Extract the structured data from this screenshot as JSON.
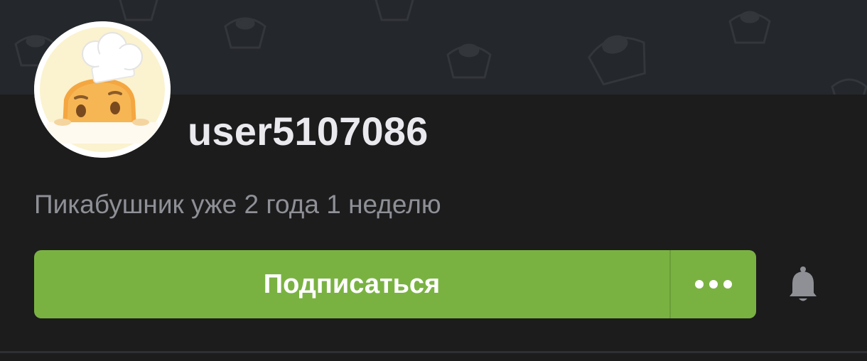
{
  "profile": {
    "username": "user5107086",
    "tenure": "Пикабушник уже 2 года 1 неделю"
  },
  "actions": {
    "subscribe_label": "Подписаться",
    "more_icon": "ellipsis-icon",
    "notify_icon": "bell-icon"
  },
  "colors": {
    "background": "#1c1c1d",
    "cover": "#24272b",
    "accent": "#7ab242",
    "username_text": "#e9e9ee",
    "secondary_text": "#8e9096"
  }
}
